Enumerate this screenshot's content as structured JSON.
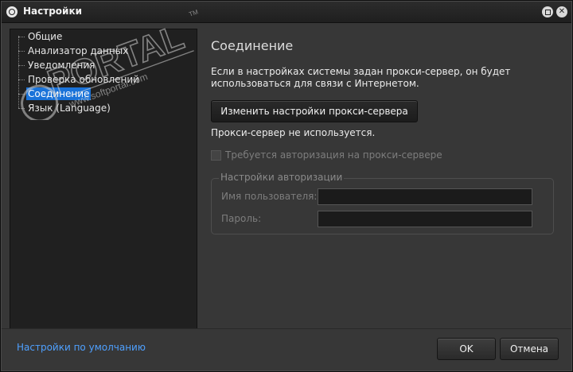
{
  "window": {
    "title": "Настройки",
    "maximize_glyph": "",
    "close_glyph": "✕"
  },
  "sidebar": {
    "items": [
      {
        "label": "Общие",
        "selected": false
      },
      {
        "label": "Анализатор данных",
        "selected": false
      },
      {
        "label": "Уведомления",
        "selected": false
      },
      {
        "label": "Проверка обновлений",
        "selected": false
      },
      {
        "label": "Соединение",
        "selected": true
      },
      {
        "label": "Язык (Language)",
        "selected": false
      }
    ]
  },
  "main": {
    "section_title": "Соединение",
    "description": "Если в настройках системы задан прокси-сервер, он будет использоваться для связи с Интернетом.",
    "proxy_button_label": "Изменить настройки прокси-сервера",
    "proxy_status": "Прокси-сервер не используется.",
    "auth_required_label": "Требуется авторизация на прокси-сервере",
    "auth_required_checked": false,
    "auth_group": {
      "title": "Настройки авторизации",
      "username_label": "Имя пользователя:",
      "username_value": "",
      "password_label": "Пароль:",
      "password_value": ""
    }
  },
  "footer": {
    "defaults_link": "Настройки по умолчанию",
    "ok_label": "OK",
    "cancel_label": "Отмена"
  },
  "watermark": {
    "text": "PORTAL",
    "url": "www.softportal.com",
    "tm": "TM"
  }
}
